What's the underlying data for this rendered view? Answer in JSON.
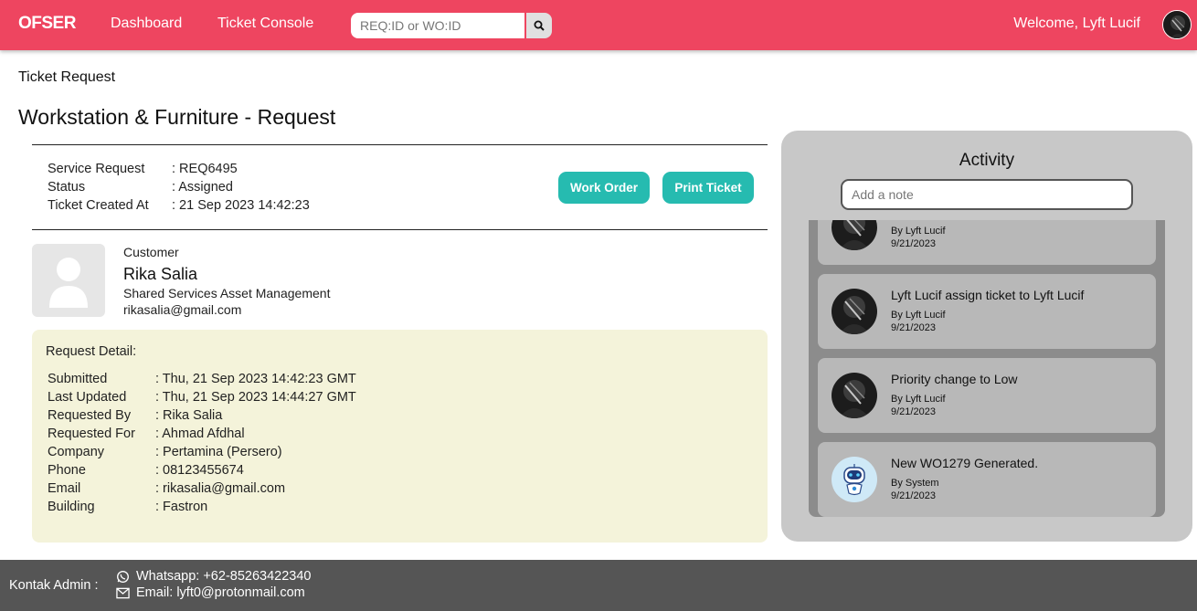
{
  "navbar": {
    "brand": "OFSER",
    "links": [
      "Dashboard",
      "Ticket Console"
    ],
    "search_placeholder": "REQ:ID or WO:ID",
    "welcome": "Welcome, Lyft Lucif",
    "colors": {
      "accent": "#ee4560"
    }
  },
  "breadcrumb": "Ticket Request",
  "page_title": "Workstation & Furniture - Request",
  "ticket": {
    "fields": [
      {
        "label": "Service Request",
        "value": ": REQ6495"
      },
      {
        "label": "Status",
        "value": ": Assigned"
      },
      {
        "label": "Ticket Created At",
        "value": ": 21 Sep 2023 14:42:23"
      }
    ],
    "buttons": {
      "work_order": "Work Order",
      "print": "Print Ticket"
    },
    "button_color": "#26bbb0"
  },
  "customer": {
    "caption": "Customer",
    "name": "Rika Salia",
    "department": "Shared Services Asset Management",
    "email": "rikasalia@gmail.com"
  },
  "request_detail": {
    "heading": "Request Detail:",
    "rows": [
      {
        "label": "Submitted",
        "value": ": Thu, 21 Sep 2023 14:42:23 GMT"
      },
      {
        "label": "Last Updated",
        "value": ": Thu, 21 Sep 2023 14:44:27 GMT"
      },
      {
        "label": "Requested By",
        "value": ": Rika Salia"
      },
      {
        "label": "Requested For",
        "value": ": Ahmad Afdhal"
      },
      {
        "label": "Company",
        "value": ": Pertamina (Persero)"
      },
      {
        "label": "Phone",
        "value": ": 08123455674"
      },
      {
        "label": "Email",
        "value": ": rikasalia@gmail.com"
      },
      {
        "label": "Building",
        "value": ": Fastron"
      }
    ]
  },
  "activity": {
    "title": "Activity",
    "note_placeholder": "Add a note",
    "items": [
      {
        "text": "",
        "by": "By Lyft Lucif",
        "date": "9/21/2023",
        "avatar": "user-avatar-icon"
      },
      {
        "text": "Lyft Lucif assign ticket to Lyft Lucif",
        "by": "By Lyft Lucif",
        "date": "9/21/2023",
        "avatar": "user-avatar-icon"
      },
      {
        "text": "Priority change to Low",
        "by": "By Lyft Lucif",
        "date": "9/21/2023",
        "avatar": "user-avatar-icon"
      },
      {
        "text": "New WO1279 Generated.",
        "by": "By System",
        "date": "9/21/2023",
        "avatar": "robot-icon"
      }
    ]
  },
  "footer": {
    "label": "Kontak Admin :",
    "whatsapp": "Whatsapp: +62-85263422340",
    "email": "Email: lyft0@protonmail.com"
  }
}
